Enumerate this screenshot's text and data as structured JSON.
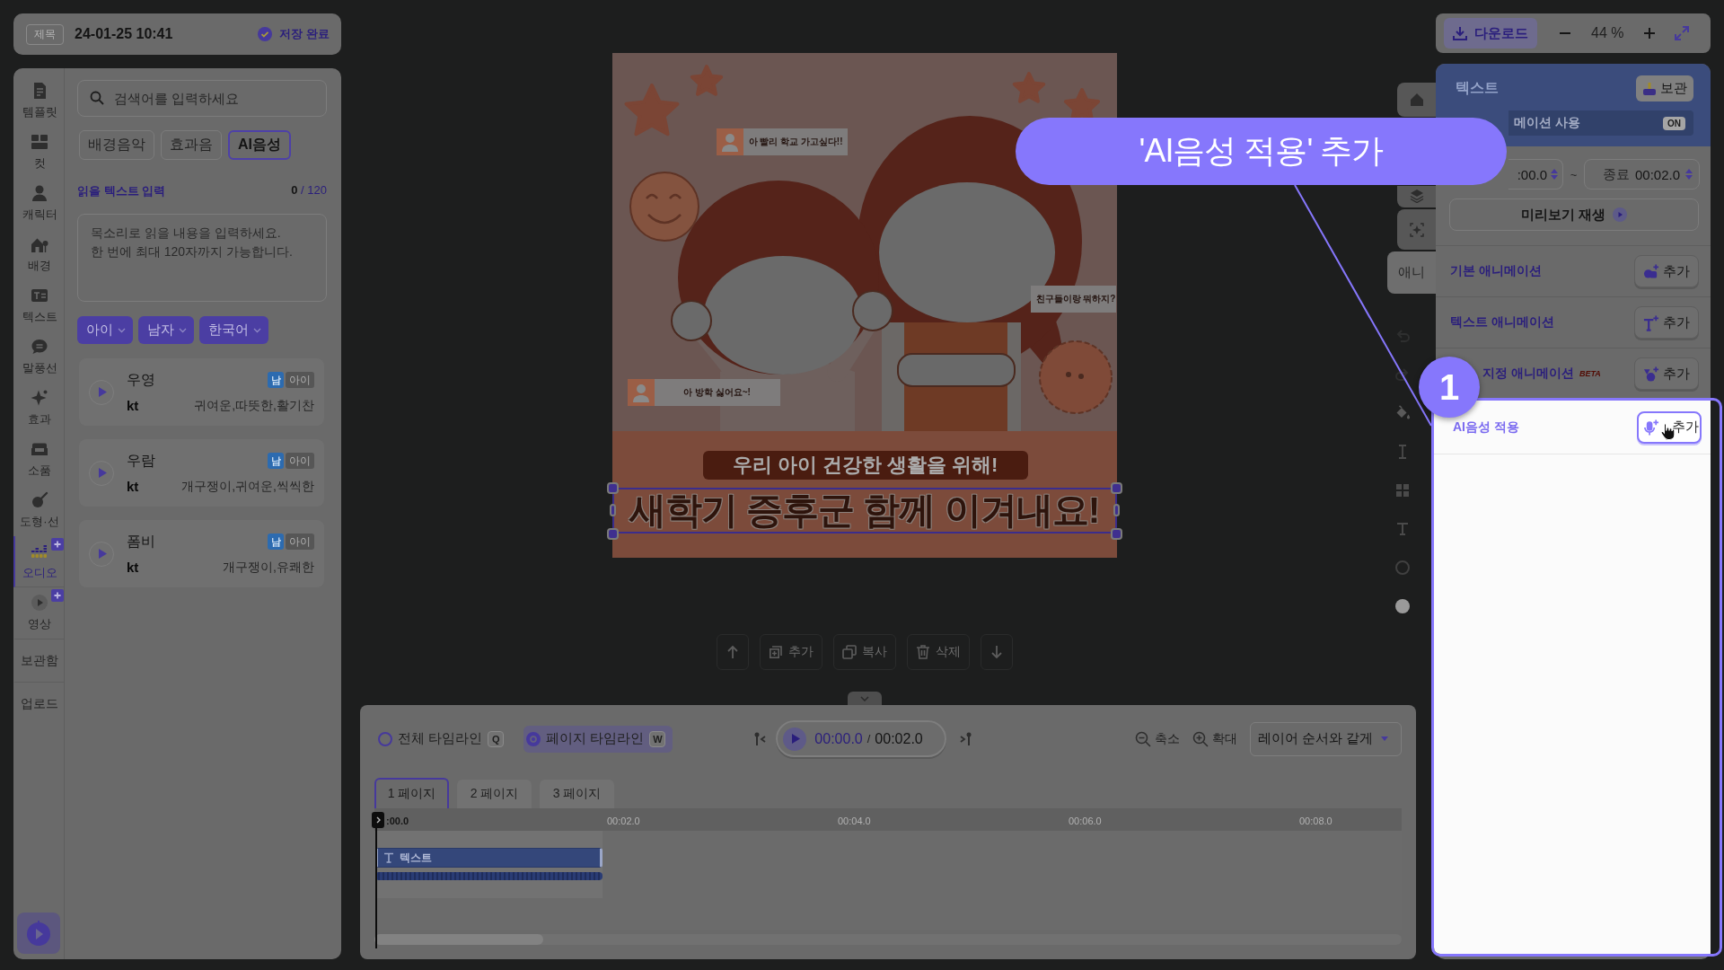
{
  "title_bar": {
    "tag": "제목",
    "title": "24-01-25 10:41",
    "save_status": "저장 완료"
  },
  "sidebar": {
    "items": [
      {
        "kind": "icon",
        "label": "템플릿",
        "selected": false,
        "plus_badge": false
      },
      {
        "kind": "icon",
        "label": "컷",
        "selected": false,
        "plus_badge": false
      },
      {
        "kind": "icon",
        "label": "캐릭터",
        "selected": false,
        "plus_badge": false
      },
      {
        "kind": "icon",
        "label": "배경",
        "selected": false,
        "plus_badge": false
      },
      {
        "kind": "icon",
        "label": "텍스트",
        "selected": false,
        "plus_badge": false
      },
      {
        "kind": "icon",
        "label": "말풍선",
        "selected": false,
        "plus_badge": false
      },
      {
        "kind": "icon",
        "label": "효과",
        "selected": false,
        "plus_badge": false
      },
      {
        "kind": "icon",
        "label": "소품",
        "selected": false,
        "plus_badge": false
      },
      {
        "kind": "icon",
        "label": "도형·선",
        "selected": false,
        "plus_badge": false
      },
      {
        "kind": "icon",
        "label": "오디오",
        "selected": true,
        "plus_badge": true
      },
      {
        "kind": "icon",
        "label": "영상",
        "selected": false,
        "plus_badge": true
      },
      {
        "kind": "text",
        "label": "보관함",
        "selected": false,
        "plus_badge": false
      },
      {
        "kind": "text",
        "label": "업로드",
        "selected": false,
        "plus_badge": false
      }
    ]
  },
  "audio_panel": {
    "search": {
      "placeholder": "검색어를 입력하세요"
    },
    "tabs": [
      {
        "label": "배경음악",
        "selected": false
      },
      {
        "label": "효과음",
        "selected": false
      },
      {
        "label": "AI음성",
        "selected": true
      }
    ],
    "input_label": "읽을 텍스트 입력",
    "counter": {
      "current": "0",
      "limit": "/ 120"
    },
    "text_input": {
      "placeholder": "목소리로 읽을 내용을 입력하세요.\n한 번에 최대 120자까지 가능합니다."
    },
    "filters": [
      "아이",
      "남자",
      "한국어"
    ],
    "voices": [
      {
        "name": "우영",
        "gender": "남",
        "age": "아이",
        "provider": "kt",
        "traits": "귀여운,따뜻한,활기찬"
      },
      {
        "name": "우람",
        "gender": "남",
        "age": "아이",
        "provider": "kt",
        "traits": "개구쟁이,귀여운,씩씩한"
      },
      {
        "name": "폼비",
        "gender": "남",
        "age": "아이",
        "provider": "kt",
        "traits": "개구쟁이,유쾌한"
      }
    ]
  },
  "canvas": {
    "bubbles": [
      {
        "kind": "avatar",
        "text": "아 빨리 학교 가고싶다!!"
      },
      {
        "kind": "plain",
        "text": "친구들이랑 뭐하지?"
      },
      {
        "kind": "avatar",
        "text": "아 방학 싫어요~!"
      }
    ],
    "subtitle": "우리 아이 건강한 생활을 위해!",
    "headline": {
      "text": "새학기 증후군 함께 이겨내요!",
      "selected": true
    }
  },
  "canvas_actions": [
    "추가",
    "복사",
    "삭제"
  ],
  "side_tabs": [
    {
      "kind": "icon",
      "selected": false
    },
    {
      "kind": "icon",
      "selected": false
    },
    {
      "kind": "icon",
      "selected": false
    },
    {
      "kind": "text",
      "label": "애니",
      "selected": true
    }
  ],
  "timeline": {
    "modes": [
      {
        "label": "전체 타임라인",
        "key": "Q",
        "selected": false
      },
      {
        "label": "페이지 타임라인",
        "key": "W",
        "selected": true
      }
    ],
    "current_time": "00:00.0",
    "separator": "/",
    "total_time": "00:02.0",
    "zoom_out": "축소",
    "zoom_in": "확대",
    "order": "레이어 순서와 같게",
    "pages": [
      {
        "label": "1 페이지",
        "selected": true
      },
      {
        "label": "2 페이지",
        "selected": false
      },
      {
        "label": "3 페이지",
        "selected": false
      }
    ],
    "ruler": [
      ":00.0",
      "00:02.0",
      "00:04.0",
      "00:06.0",
      "00:08.0"
    ],
    "clips": [
      {
        "label": "텍스트"
      }
    ]
  },
  "toolbar": {
    "download": "다운로드",
    "zoom_level": "44 %"
  },
  "properties": {
    "title": "텍스트",
    "archive": "보관",
    "animation": {
      "label": "메이션 사용",
      "on": true,
      "state": "ON"
    },
    "start_time": ":00.0",
    "range_separator": "~",
    "end_time": {
      "label": "종료",
      "value": "00:02.0"
    },
    "preview": "미리보기 재생",
    "rows": [
      {
        "label": "기본 애니메이션",
        "button": "추가",
        "highlighted": false
      },
      {
        "label": "텍스트 애니메이션",
        "button": "추가",
        "highlighted": false
      },
      {
        "label": "지정 애니메이션",
        "tag": "BETA",
        "button": "추가",
        "highlighted": false
      },
      {
        "label": "AI음성 적용",
        "button": "추가",
        "highlighted": true
      }
    ]
  },
  "tutorial": {
    "callout": "'AI음성 적용' 추가",
    "step": "1"
  }
}
